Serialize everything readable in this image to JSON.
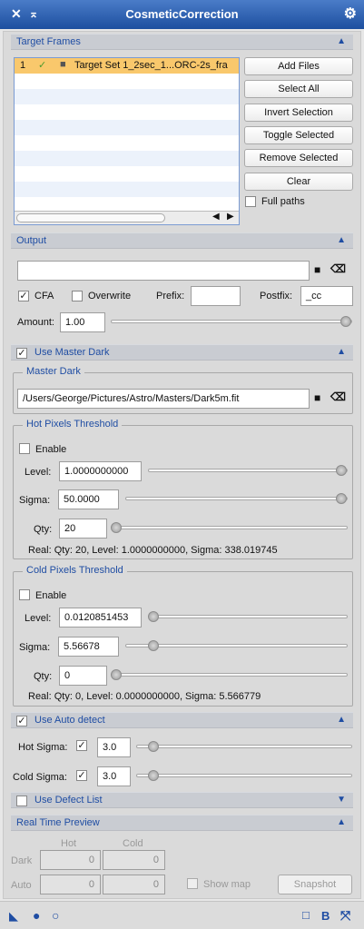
{
  "window": {
    "title": "CosmeticCorrection"
  },
  "target_frames": {
    "section_label": "Target Frames",
    "rows": [
      {
        "index": "1",
        "check": "✓",
        "label": "Target Set 1_2sec_1...ORC-2s_fra"
      }
    ],
    "buttons": {
      "add_files": "Add Files",
      "select_all": "Select All",
      "invert_selection": "Invert Selection",
      "toggle_selected": "Toggle Selected",
      "remove_selected": "Remove Selected",
      "clear": "Clear"
    },
    "full_paths_label": "Full paths"
  },
  "output": {
    "section_label": "Output",
    "directory_value": "",
    "cfa_label": "CFA",
    "overwrite_label": "Overwrite",
    "prefix_label": "Prefix:",
    "prefix_value": "",
    "postfix_label": "Postfix:",
    "postfix_value": "_cc",
    "amount_label": "Amount:",
    "amount_value": "1.00",
    "amount_fraction": 1.0
  },
  "master_dark": {
    "section_label": "Use Master Dark",
    "group_label": "Master Dark",
    "path": "/Users/George/Pictures/Astro/Masters/Dark5m.fit",
    "hot": {
      "group_label": "Hot Pixels Threshold",
      "enable_label": "Enable",
      "level_label": "Level:",
      "level_value": "1.0000000000",
      "sigma_label": "Sigma:",
      "sigma_value": "50.0000",
      "qty_label": "Qty:",
      "qty_value": "20",
      "real_text": "Real: Qty: 20, Level: 1.0000000000, Sigma: 338.019745"
    },
    "cold": {
      "group_label": "Cold Pixels Threshold",
      "enable_label": "Enable",
      "level_label": "Level:",
      "level_value": "0.0120851453",
      "sigma_label": "Sigma:",
      "sigma_value": "5.56678",
      "qty_label": "Qty:",
      "qty_value": "0",
      "real_text": "Real: Qty: 0, Level: 0.0000000000, Sigma: 5.566779"
    }
  },
  "auto_detect": {
    "section_label": "Use Auto detect",
    "hot_sigma_label": "Hot Sigma:",
    "hot_sigma_value": "3.0",
    "cold_sigma_label": "Cold Sigma:",
    "cold_sigma_value": "3.0"
  },
  "defect_list": {
    "section_label": "Use Defect List"
  },
  "preview": {
    "section_label": "Real Time Preview",
    "hot_label": "Hot",
    "cold_label": "Cold",
    "dark_label": "Dark",
    "auto_label": "Auto",
    "dark_hot": "0",
    "dark_cold": "0",
    "auto_hot": "0",
    "auto_cold": "0",
    "show_map_label": "Show map",
    "snapshot_label": "Snapshot"
  },
  "icons": {
    "close": "close-icon",
    "shade": "shade-icon",
    "settings": "gear-icon"
  },
  "colors": {
    "titlebar": "#2d5fb0",
    "section_text": "#1f4da3",
    "selected_row": "#f9c86c"
  }
}
